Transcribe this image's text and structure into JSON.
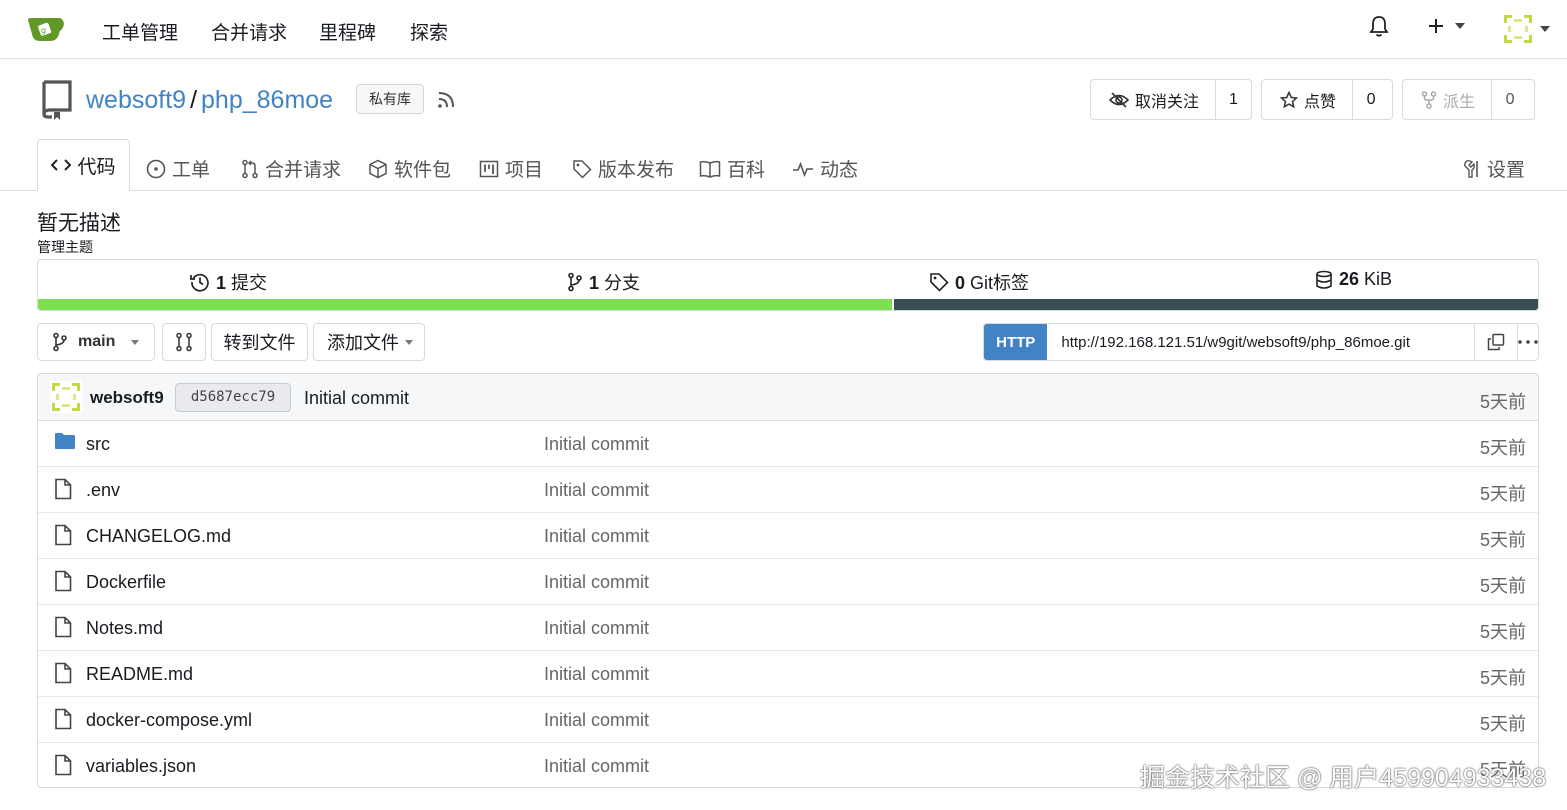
{
  "nav": {
    "items": [
      "工单管理",
      "合并请求",
      "里程碑",
      "探索"
    ]
  },
  "repo": {
    "owner": "websoft9",
    "separator": "/",
    "name": "php_86moe",
    "visibility": "私有库",
    "watch_label": "取消关注",
    "watch_count": "1",
    "star_label": "点赞",
    "star_count": "0",
    "fork_label": "派生",
    "fork_count": "0"
  },
  "tabs": {
    "code": "代码",
    "issues": "工单",
    "pulls": "合并请求",
    "packages": "软件包",
    "projects": "项目",
    "releases": "版本发布",
    "wiki": "百科",
    "activity": "动态",
    "settings": "设置"
  },
  "description": "暂无描述",
  "topics_label": "管理主题",
  "stats": {
    "commits_num": "1",
    "commits_label": "提交",
    "branches_num": "1",
    "branches_label": "分支",
    "tags_num": "0",
    "tags_label": "Git标签",
    "size_num": "26",
    "size_unit": "KiB"
  },
  "languages": [
    {
      "color": "#7ee050",
      "fraction": 0.57
    },
    {
      "color": "#394c51",
      "fraction": 0.43
    }
  ],
  "toolbar": {
    "branch": "main",
    "goto_file": "转到文件",
    "add_file": "添加文件",
    "clone_protocol": "HTTP",
    "clone_url": "http://192.168.121.51/w9git/websoft9/php_86moe.git"
  },
  "latest_commit": {
    "author": "websoft9",
    "sha": "d5687ecc79",
    "message": "Initial commit",
    "time": "5天前"
  },
  "files": [
    {
      "name": "src",
      "type": "folder",
      "message": "Initial commit",
      "time": "5天前"
    },
    {
      "name": ".env",
      "type": "file",
      "message": "Initial commit",
      "time": "5天前"
    },
    {
      "name": "CHANGELOG.md",
      "type": "file",
      "message": "Initial commit",
      "time": "5天前"
    },
    {
      "name": "Dockerfile",
      "type": "file",
      "message": "Initial commit",
      "time": "5天前"
    },
    {
      "name": "Notes.md",
      "type": "file",
      "message": "Initial commit",
      "time": "5天前"
    },
    {
      "name": "README.md",
      "type": "file",
      "message": "Initial commit",
      "time": "5天前"
    },
    {
      "name": "docker-compose.yml",
      "type": "file",
      "message": "Initial commit",
      "time": "5天前"
    },
    {
      "name": "variables.json",
      "type": "file",
      "message": "Initial commit",
      "time": "5天前"
    }
  ],
  "watermark": "掘金技术社区 @ 用户459904933438",
  "colors": {
    "accent": "#4183c4",
    "brand": "#609926"
  }
}
